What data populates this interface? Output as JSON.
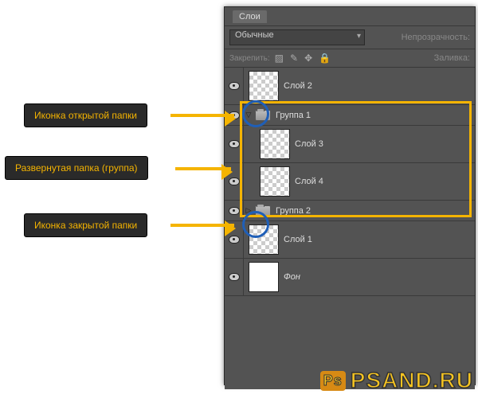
{
  "panel": {
    "title": "Слои",
    "blend_mode": "Обычные",
    "opacity_label": "Непрозрачность:",
    "lock_label": "Закрепить:",
    "fill_label": "Заливка:"
  },
  "layers": [
    {
      "kind": "layer",
      "name": "Слой 2",
      "indent": 0,
      "visible": true,
      "thumb": "checker"
    },
    {
      "kind": "group",
      "name": "Группа 1",
      "indent": 0,
      "visible": true,
      "expanded": true
    },
    {
      "kind": "layer",
      "name": "Слой 3",
      "indent": 1,
      "visible": true,
      "thumb": "checker"
    },
    {
      "kind": "layer",
      "name": "Слой 4",
      "indent": 1,
      "visible": true,
      "thumb": "checker"
    },
    {
      "kind": "group",
      "name": "Группа 2",
      "indent": 0,
      "visible": true,
      "expanded": false
    },
    {
      "kind": "layer",
      "name": "Слой 1",
      "indent": 0,
      "visible": true,
      "thumb": "checker"
    },
    {
      "kind": "layer",
      "name": "Фон",
      "indent": 0,
      "visible": true,
      "thumb": "white",
      "italic": true
    }
  ],
  "annotations": [
    {
      "key": "open_folder_icon",
      "text": "Иконка открытой папки"
    },
    {
      "key": "expanded_group_box",
      "text": "Развернутая папка (группа)"
    },
    {
      "key": "closed_folder_icon",
      "text": "Иконка закрытой папки"
    }
  ],
  "watermark": {
    "badge": "Ps",
    "text": "PSAND.RU"
  }
}
